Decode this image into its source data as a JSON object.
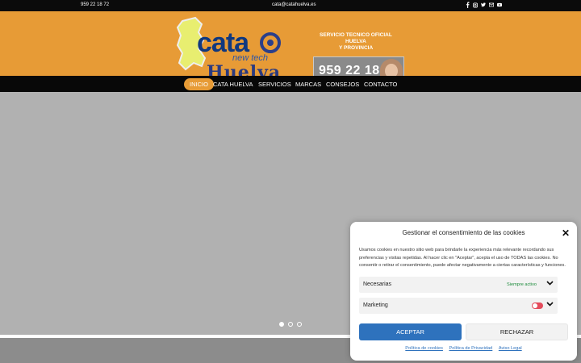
{
  "topbar": {
    "phone": "959 22 18 72",
    "email": "cata@catahuelva.es",
    "social_icons": [
      "facebook-icon",
      "instagram-icon",
      "twitter-icon",
      "mail-icon",
      "youtube-icon"
    ]
  },
  "header": {
    "logo": {
      "brand": "cata",
      "tagline": "new tech",
      "city": "Huelva"
    },
    "service": {
      "line1": "SERVICIO TECNICO OFICIAL",
      "line2": "HUELVA",
      "line3": "Y PROVINCIA"
    },
    "banner_phone": "959 22 18 72"
  },
  "nav": {
    "items": [
      {
        "label": "INICIO",
        "active": true
      },
      {
        "label": "CATA HUELVA",
        "active": false
      },
      {
        "label": "SERVICIOS",
        "active": false
      },
      {
        "label": "MARCAS",
        "active": false
      },
      {
        "label": "CONSEJOS",
        "active": false
      },
      {
        "label": "CONTACTO",
        "active": false
      }
    ]
  },
  "slider": {
    "dot_count": 3,
    "active_dot": 1
  },
  "consent": {
    "title": "Gestionar el consentimiento de las cookies",
    "close_symbol": "✕",
    "body": "Usamos cookies en nuestro sitio web para brindarle la experiencia más relevante recordando sus preferencias y visitas repetidas. Al hacer clic en \"Aceptar\", acepta el uso de TODAS las cookies. No consentir o retirar el consentimiento, puede afectar negativamente a ciertas características y funciones.",
    "categories": [
      {
        "label": "Necesarias",
        "status": "Siempre activo"
      },
      {
        "label": "Marketing",
        "status": ""
      }
    ],
    "accept": "ACEPTAR",
    "reject": "RECHAZAR",
    "links": [
      "Política de cookies",
      "Política de Privacidad",
      "Aviso Legal"
    ],
    "colors": {
      "accent": "#2e72bd",
      "toggle_off": "#e44c5c",
      "active_text": "#1c8b3b"
    }
  },
  "colors": {
    "brand_orange": "#e79b36",
    "nav_bg": "#080808"
  }
}
